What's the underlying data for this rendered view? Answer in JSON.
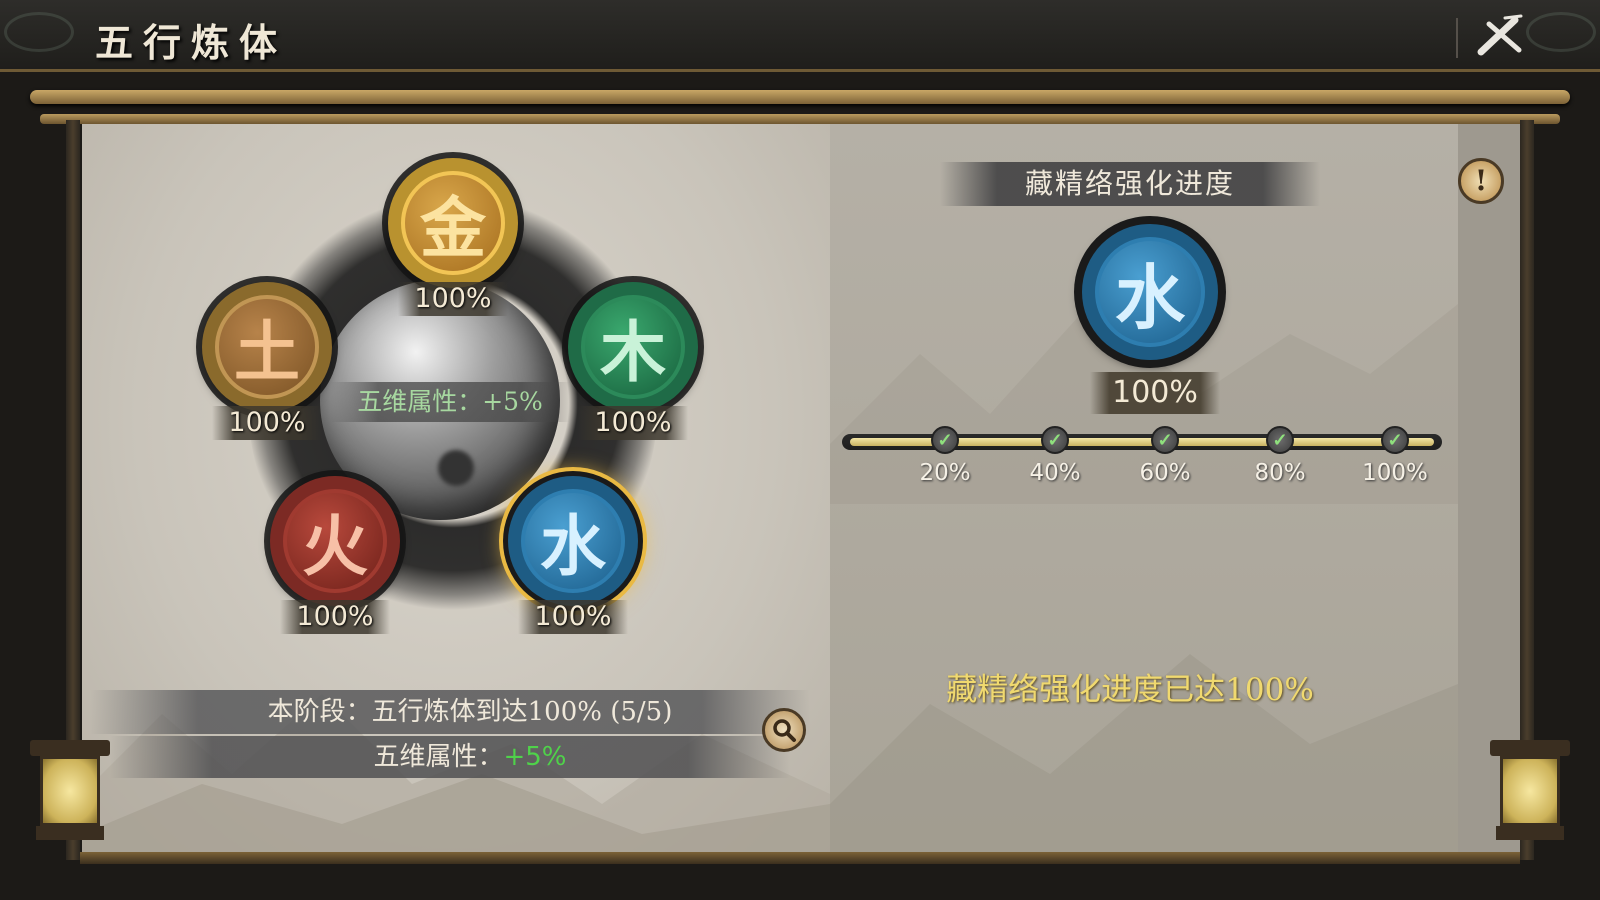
{
  "title": "五行炼体",
  "center_attr": "五维属性：+5%",
  "elements": {
    "metal": {
      "glyph": "金",
      "percent": "100%"
    },
    "earth": {
      "glyph": "土",
      "percent": "100%"
    },
    "wood": {
      "glyph": "木",
      "percent": "100%"
    },
    "fire": {
      "glyph": "火",
      "percent": "100%"
    },
    "water": {
      "glyph": "水",
      "percent": "100%"
    }
  },
  "stage": {
    "text": "本阶段：五行炼体到达100% (5/5)",
    "attr_label": "五维属性：",
    "attr_value": "+5%"
  },
  "right": {
    "header": "藏精络强化进度",
    "selected_glyph": "水",
    "selected_percent": "100%",
    "progress": 1.0,
    "milestones": [
      "20%",
      "40%",
      "60%",
      "80%",
      "100%"
    ],
    "complete_message": "藏精络强化进度已达100%"
  },
  "colors": {
    "accent_gold": "#e9b943",
    "attr_green": "#4fd24a",
    "complete_yellow": "#f0d96f"
  },
  "icons": [
    "close-icon",
    "search-icon",
    "info-icon",
    "check-icon"
  ]
}
